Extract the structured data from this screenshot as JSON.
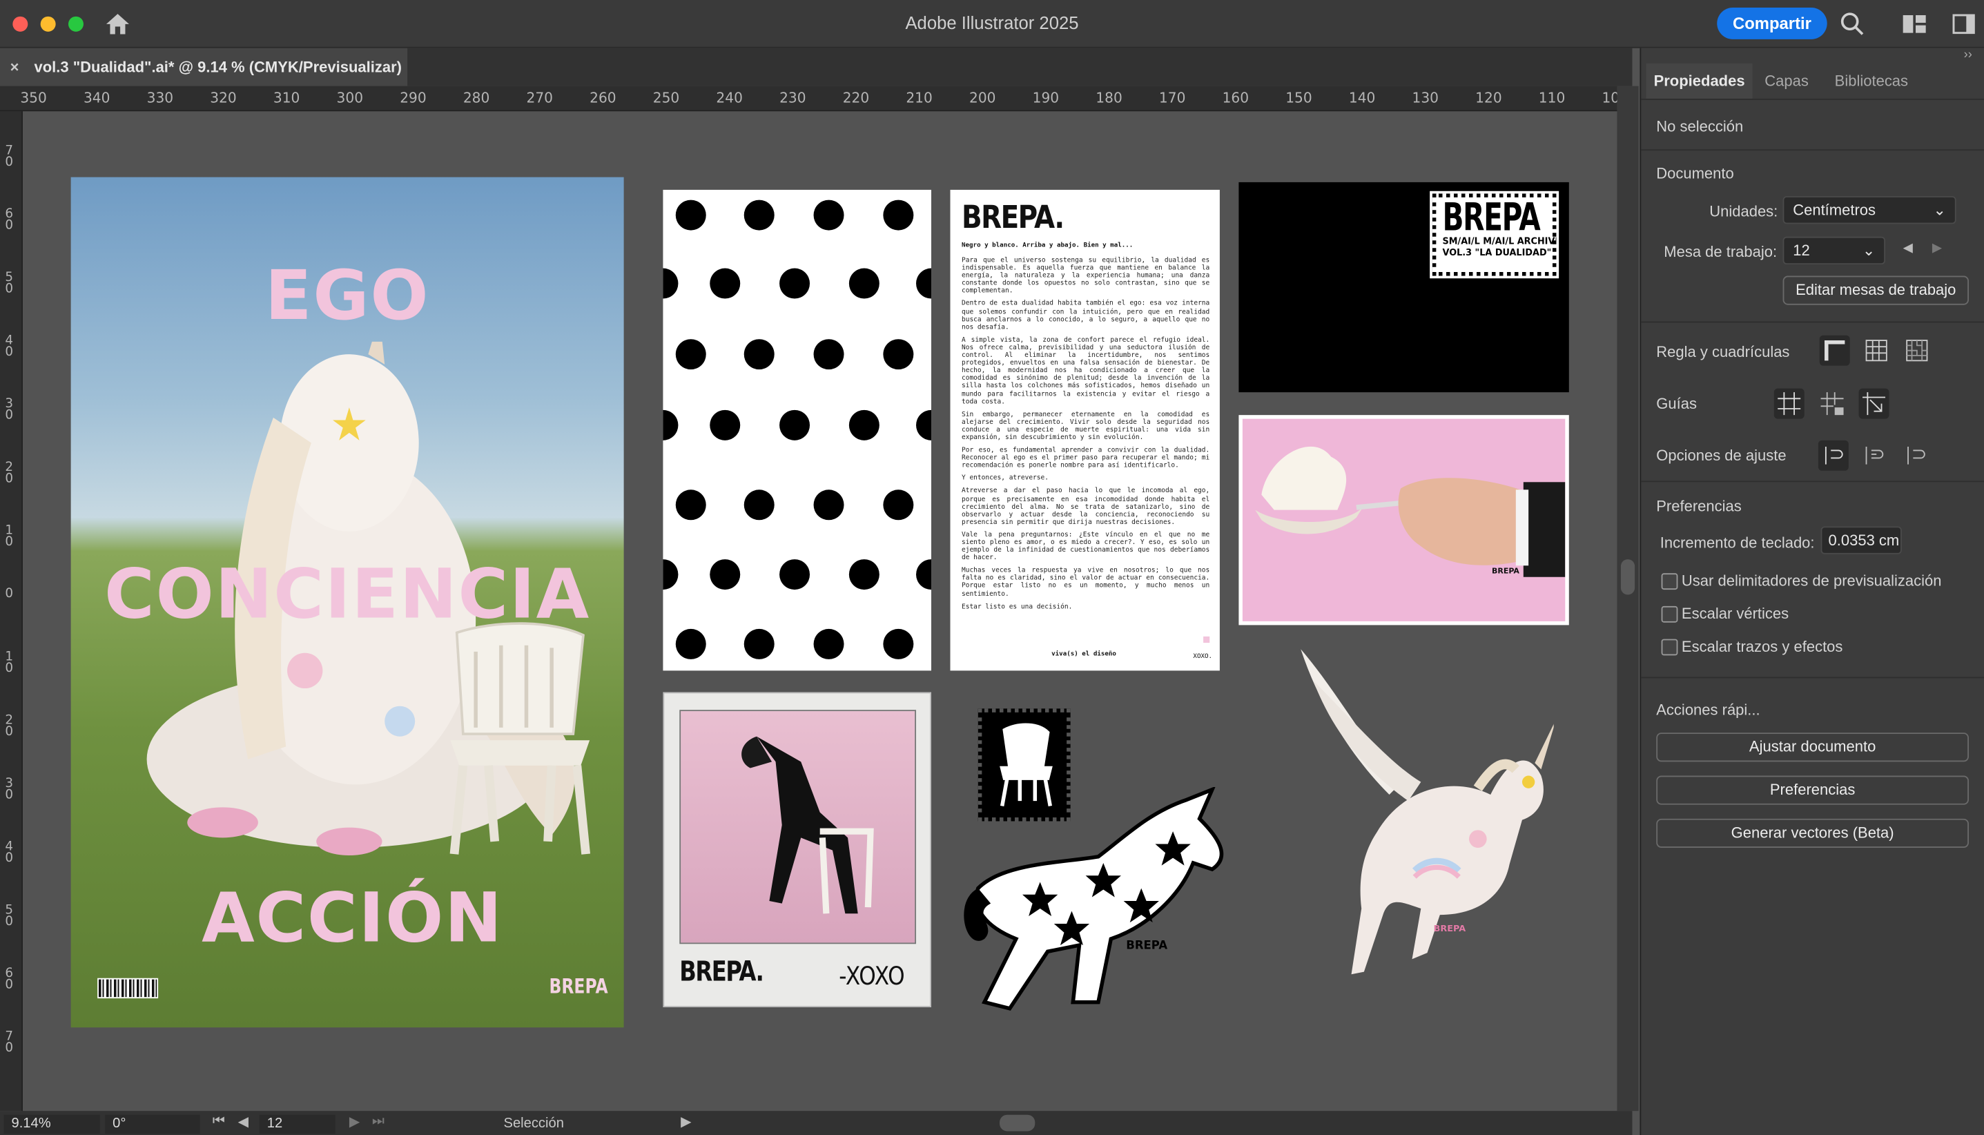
{
  "window": {
    "title": "Adobe Illustrator 2025",
    "share_label": "Compartir"
  },
  "tab": {
    "label": "vol.3 \"Dualidad\".ai* @ 9.14 % (CMYK/Previsualizar)",
    "close": "×"
  },
  "ruler": {
    "h": [
      "350",
      "340",
      "330",
      "320",
      "310",
      "300",
      "290",
      "280",
      "270",
      "260",
      "250",
      "240",
      "230",
      "220",
      "210",
      "200",
      "190",
      "180",
      "170",
      "160",
      "150",
      "140",
      "130",
      "120",
      "110",
      "10"
    ],
    "v": [
      "7\n0",
      "6\n0",
      "5\n0",
      "4\n0",
      "3\n0",
      "2\n0",
      "1\n0",
      "0",
      "1\n0",
      "2\n0",
      "3\n0",
      "4\n0",
      "5\n0",
      "6\n0",
      "7\n0"
    ]
  },
  "artboards": {
    "poster": {
      "word1": "EGO",
      "word2": "CONCIENCIA",
      "word3": "ACCIÓN",
      "brand": "BREPA"
    },
    "letter": {
      "brand": "BREPA.",
      "subtitle": "Negro y blanco. Arriba y abajo. Bien y mal...",
      "paragraphs": [
        "Para que el universo sostenga su equilibrio, la dualidad es indispensable. Es aquella fuerza que mantiene en balance la energía, la naturaleza y la experiencia humana; una danza constante donde los opuestos no solo contrastan, sino que se complementan.",
        "Dentro de esta dualidad habita también el ego: esa voz interna que solemos confundir con la intuición, pero que en realidad busca anclarnos a lo conocido, a lo seguro, a aquello que no nos desafía.",
        "A simple vista, la zona de confort parece el refugio ideal. Nos ofrece calma, previsibilidad y una seductora ilusión de control. Al eliminar la incertidumbre, nos sentimos protegidos, envueltos en una falsa sensación de bienestar. De hecho, la modernidad nos ha condicionado a creer que la comodidad es sinónimo de plenitud; desde la invención de la silla hasta los colchones más sofisticados, hemos diseñado un mundo para facilitarnos la existencia y evitar el riesgo a toda costa.",
        "Sin embargo, permanecer eternamente en la comodidad es alejarse del crecimiento. Vivir solo desde la seguridad nos conduce a una especie de muerte espiritual: una vida sin expansión, sin descubrimiento y sin evolución.",
        "Por eso, es fundamental aprender a convivir con la dualidad. Reconocer al ego es el primer paso para recuperar el mando; mi recomendación es ponerle nombre para así identificarlo.",
        "Y entonces, atreverse.",
        "Atreverse a dar el paso hacia lo que le incomoda al ego, porque es precisamente en esa incomodidad donde habita el crecimiento del alma. No se trata de satanizarlo, sino de observarlo y actuar desde la conciencia, reconociendo su presencia sin permitir que dirija nuestras decisiones.",
        "Vale la pena preguntarnos: ¿Este vínculo en el que no me siento pleno es amor, o es miedo a crecer?. Y eso, es solo un ejemplo de la infinidad de cuestionamientos que nos deberíamos de hacer.",
        "Muchas veces la respuesta ya vive en nosotros; lo que nos falta no es claridad, sino el valor de actuar en consecuencia. Porque estar listo no es un momento, y mucho menos un sentimiento.",
        "Estar listo es una decisión."
      ],
      "signature": "viva(s) el diseño",
      "xoxo": "XOXO."
    },
    "stamp": {
      "brand": "BREPA",
      "line1": "SM/AI/L M/AI/L ARCHIVE",
      "line2": "VOL.3 \"LA DUALIDAD\""
    },
    "polaroid": {
      "brand": "BREPA.",
      "sign": "-XOXO"
    },
    "unicorn_label": "BREPA",
    "cup_label": "BREPA"
  },
  "status": {
    "zoom": "9.14%",
    "rotation": "0°",
    "artboard": "12",
    "tool": "Selección"
  },
  "panel": {
    "tabs": [
      "Propiedades",
      "Capas",
      "Bibliotecas"
    ],
    "selection": "No selección",
    "documento": "Documento",
    "unidades_label": "Unidades:",
    "unidades_value": "Centímetros",
    "mesa_label": "Mesa de trabajo:",
    "mesa_value": "12",
    "editar_button": "Editar mesas de trabajo",
    "regla_label": "Regla y cuadrículas",
    "guias_label": "Guías",
    "ajuste_label": "Opciones de ajuste",
    "preferencias_title": "Preferencias",
    "incremento_label": "Incremento de teclado:",
    "incremento_value": "0.0353 cm",
    "check1": "Usar delimitadores de previsualización",
    "check2": "Escalar vértices",
    "check3": "Escalar trazos y efectos",
    "acciones_title": "Acciones rápi...",
    "btn_ajustar": "Ajustar documento",
    "btn_pref": "Preferencias",
    "btn_generar": "Generar vectores (Beta)"
  },
  "colors": {
    "accent": "#1473e6",
    "pink": "#f2c4dc",
    "panel": "#3c3c3c",
    "canvas": "#535353"
  }
}
